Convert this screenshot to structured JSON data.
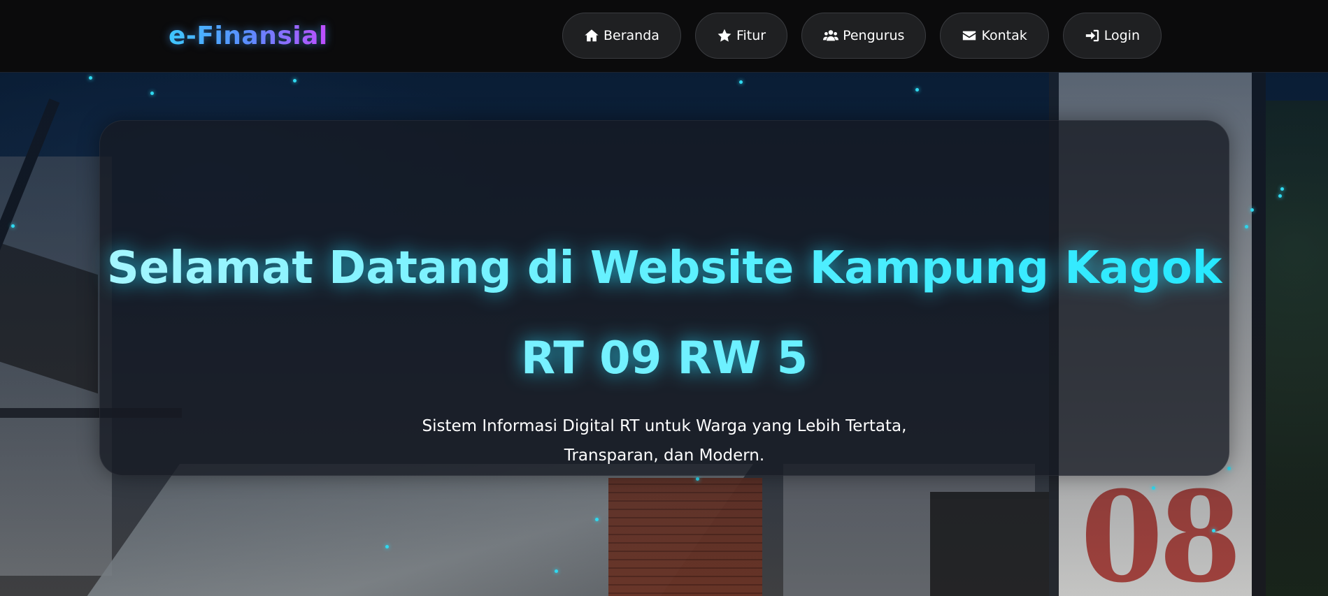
{
  "brand": {
    "name": "e-Finansial"
  },
  "nav": {
    "items": [
      {
        "label": "Beranda",
        "icon": "home-icon"
      },
      {
        "label": "Fitur",
        "icon": "star-icon"
      },
      {
        "label": "Pengurus",
        "icon": "users-icon"
      },
      {
        "label": "Kontak",
        "icon": "envelope-icon"
      },
      {
        "label": "Login",
        "icon": "sign-in-icon"
      }
    ]
  },
  "hero": {
    "title_line1": "Selamat Datang di Website Kampung Kagok",
    "title_line2": "RT 09 RW 5",
    "subtitle_line1": "Sistem Informasi Digital RT untuk Warga yang Lebih Tertata,",
    "subtitle_line2": "Transparan, dan Modern.",
    "background_sign_number": "08"
  },
  "colors": {
    "navbar_bg": "#0b0b0c",
    "title_accent": "#4ff0ff",
    "brand_gradient_start": "#3fc8ff",
    "brand_gradient_end": "#c04dff",
    "particle": "#2fd9f0"
  }
}
